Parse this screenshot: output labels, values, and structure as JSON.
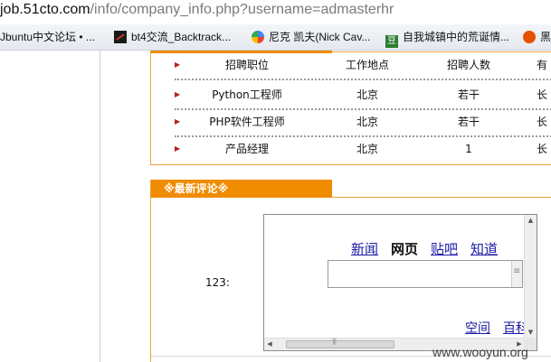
{
  "address_bar": {
    "domain": "job.51cto.com",
    "path": "/info/company_info.php?username=admasterhr"
  },
  "bookmarks": [
    {
      "label": "Jbuntu中文论坛 • ...",
      "icon": "ubuntu-icon"
    },
    {
      "label": "bt4交流_Backtrack...",
      "icon": "backtrack-icon"
    },
    {
      "label": "尼克 凯夫(Nick Cav...",
      "icon": "search-engine-icon"
    },
    {
      "label": "自我城镇中的荒诞情...",
      "icon": "douban-icon"
    },
    {
      "label": "黑",
      "icon": "firefox-icon"
    }
  ],
  "jobs": {
    "headers": [
      "招聘职位",
      "工作地点",
      "招聘人数",
      "有"
    ],
    "rows": [
      [
        "Python工程师",
        "北京",
        "若干",
        "长"
      ],
      [
        "PHP软件工程师",
        "北京",
        "若干",
        "长"
      ],
      [
        "产品经理",
        "北京",
        "1",
        "长"
      ]
    ]
  },
  "comments": {
    "tab_label": "※最新评论※",
    "commenter": "123:"
  },
  "embedded_frame": {
    "nav_links": [
      "新闻",
      "网页",
      "贴吧",
      "知道"
    ],
    "active_nav": "网页",
    "search_value": "",
    "bottom_links": [
      "空间",
      "百科"
    ]
  },
  "watermark": "www.wooyun.org"
}
